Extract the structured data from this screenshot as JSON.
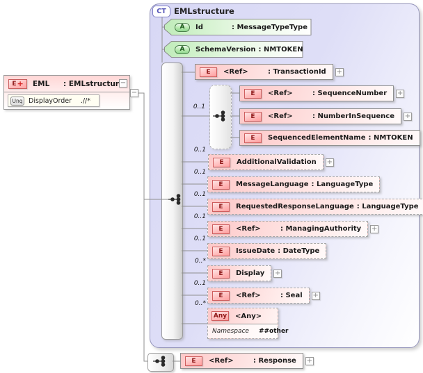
{
  "eml": {
    "badge": "E",
    "badge_modifier": "+",
    "name": "EML",
    "type": ": EMLstructure",
    "collapse_glyph": "−",
    "link_glyph": "−",
    "unique_constraint": {
      "badge": "Unq",
      "name": "DisplayOrder",
      "xpath": ".//*"
    }
  },
  "complex_type": {
    "badge": "CT",
    "title": "EMLstructure",
    "attributes": [
      {
        "badge": "A",
        "name": "Id",
        "type": ": MessageTypeType"
      },
      {
        "badge": "A",
        "name": "SchemaVersion",
        "type": ": NMTOKEN"
      }
    ],
    "children": [
      {
        "badge": "E",
        "name": "<Ref>",
        "type": ": TransactionId",
        "expand_glyph": "+"
      },
      {
        "cardinality": "0..1",
        "kind": "sequence-group",
        "children": [
          {
            "badge": "E",
            "name": "<Ref>",
            "type": ": SequenceNumber",
            "expand_glyph": "+"
          },
          {
            "badge": "E",
            "name": "<Ref>",
            "type": ": NumberInSequence",
            "expand_glyph": "+"
          },
          {
            "badge": "E",
            "name": "SequencedElementName",
            "type": ": NMTOKEN"
          }
        ]
      },
      {
        "cardinality": "0..1",
        "badge": "E",
        "name": "AdditionalValidation",
        "expand_glyph": "+"
      },
      {
        "cardinality": "0..1",
        "badge": "E",
        "name": "MessageLanguage",
        "type": ": LanguageType"
      },
      {
        "cardinality": "0..1",
        "badge": "E",
        "name": "RequestedResponseLanguage",
        "type": ": LanguageType"
      },
      {
        "cardinality": "0..1",
        "badge": "E",
        "name": "<Ref>",
        "type": ": ManagingAuthority",
        "expand_glyph": "+"
      },
      {
        "cardinality": "0..1",
        "badge": "E",
        "name": "IssueDate",
        "type": ": DateType"
      },
      {
        "cardinality": "0..*",
        "badge": "E",
        "name": "Display",
        "expand_glyph": "+"
      },
      {
        "cardinality": "0..1",
        "badge": "E",
        "name": "<Ref>",
        "type": ": Seal",
        "expand_glyph": "+"
      },
      {
        "cardinality": "0..*",
        "badge": "Any",
        "name": "<Any>",
        "namespace_label": "Namespace",
        "namespace_value": "##other"
      }
    ]
  },
  "response": {
    "badge": "E",
    "name": "<Ref>",
    "type": ": Response",
    "expand_glyph": "+"
  },
  "colors": {
    "element_fill": "#fdc9c9",
    "attribute_fill": "#c0ecba",
    "complex_type_fill": "#dcdcf7",
    "connector": "#8f8f8f"
  }
}
